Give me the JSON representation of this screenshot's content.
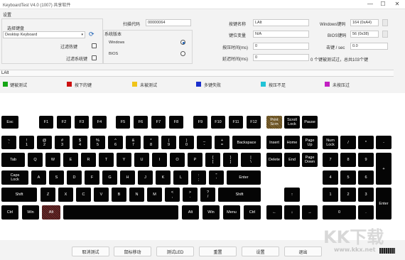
{
  "window": {
    "title": "KeyboardTest V4.0 (1007) 共享软件",
    "min": "—",
    "max": "☐",
    "close": "✕"
  },
  "settings": {
    "section_label": "设置",
    "kb_select_label": "选择键盘",
    "kb_select_value": "Desktop Keyboard",
    "chk1_label": "过滤热键",
    "chk2_label": "过滤系统键",
    "os_group_label": "系统版本",
    "os_windows": "Windows",
    "os_bios": "BIOS",
    "scancode_label": "扫描代码",
    "scancode_value": "00000064",
    "keyname_label": "按键名称",
    "keyname_value": "LAlt",
    "keycode_label": "键位变量",
    "keycode_value": "N/A",
    "press_time_label": "按压时间(ms)",
    "press_time_value": "0",
    "delay_label": "延迟时间(ms)",
    "delay_value": "0",
    "winvk_label": "Windows键码",
    "winvk_value": "164 (0xA4)",
    "bios_label": "BIOS键码",
    "bios_value": "56 (0x38)",
    "rate_label": "击键 / sec",
    "rate_value": "0.0",
    "stats_text": "0 个键被测试过，总共103个键"
  },
  "log_text": "LAlt",
  "legend": [
    {
      "label": "键被测试",
      "color": "#16a616"
    },
    {
      "label": "按下的键",
      "color": "#cc1111"
    },
    {
      "label": "未被测试",
      "color": "#f0c419"
    },
    {
      "label": "多键失败",
      "color": "#1a2fcc"
    },
    {
      "label": "按压不足",
      "color": "#22c3d6"
    },
    {
      "label": "未按压过",
      "color": "#c21fc2"
    }
  ],
  "keys": {
    "esc": "Esc",
    "f1": "F1",
    "f2": "F2",
    "f3": "F3",
    "f4": "F4",
    "f5": "F5",
    "f6": "F6",
    "f7": "F7",
    "f8": "F8",
    "f9": "F9",
    "f10": "F10",
    "f11": "F11",
    "f12": "F12",
    "prtsc": "Print\nScrn",
    "scroll": "Scroll\nLock",
    "pause": "Pause",
    "tilde": "~\n`",
    "d1": "!\n1",
    "d2": "@\n2",
    "d3": "#\n3",
    "d4": "$\n4",
    "d5": "%\n5",
    "d6": "^\n6",
    "d7": "&\n7",
    "d8": "*\n8",
    "d9": "(\n9",
    "d0": ")\n0",
    "minus": "_\n-",
    "equal": "+\n=",
    "backspace": "Backspace",
    "insert": "Insert",
    "home": "Home",
    "pgup": "Page\nUp",
    "numlock": "Num\nLock",
    "ndiv": "/",
    "nmul": "*",
    "nminus": "-",
    "tab": "Tab",
    "q": "Q",
    "w": "W",
    "e": "E",
    "r": "R",
    "t": "T",
    "y": "Y",
    "u": "U",
    "i": "I",
    "o": "O",
    "p": "P",
    "lbr": "{\n[",
    "rbr": "}\n]",
    "bslash": "|\n\\",
    "delete": "Delete",
    "end": "End",
    "pgdn": "Page\nDown",
    "n7": "7",
    "n8": "8",
    "n9": "9",
    "nplus": "+",
    "caps": "Caps\nLock",
    "a": "A",
    "s": "S",
    "d": "D",
    "f": "F",
    "g": "G",
    "h": "H",
    "j": "J",
    "k": "K",
    "l": "L",
    "semi": ":\n;",
    "quote": "\"\n'",
    "enter": "Enter",
    "n4": "4",
    "n5": "5",
    "n6": "6",
    "lshift": "Shift",
    "z": "Z",
    "x": "X",
    "c": "C",
    "v": "V",
    "b": "B",
    "n": "N",
    "m": "M",
    "comma": "<\n,",
    "period": ">\n.",
    "slash": "?\n/",
    "rshift": "Shift",
    "up": "↑",
    "n1": "1",
    "n2": "2",
    "n3": "3",
    "nenter": "Enter",
    "lctrl": "Ctrl",
    "lwin": "Win",
    "lalt": "Alt",
    "ralt": "Alt",
    "rwin": "Win",
    "menu": "Menu",
    "rctrl": "Ctrl",
    "left": "←",
    "down": "↓",
    "right": "→",
    "n0": "0",
    "ndot": "."
  },
  "buttons": {
    "reset": "取消测试",
    "mouse": "鼠标移动",
    "led": "测试LED",
    "restart": "重置",
    "settings": "设置",
    "exit": "退出"
  },
  "watermark": {
    "brand": "KK下载",
    "url": "www.kkx.net"
  }
}
